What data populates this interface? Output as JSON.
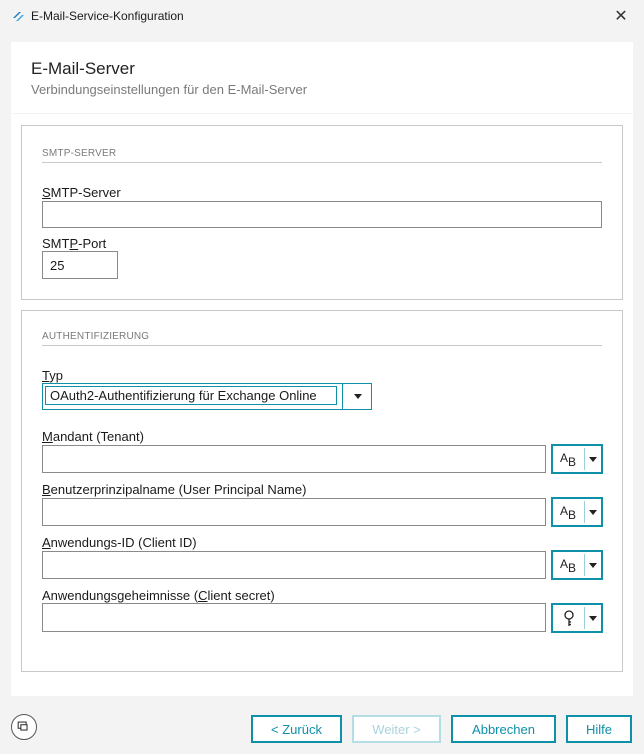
{
  "window": {
    "title": "E-Mail-Service-Konfiguration",
    "close_label": "✕"
  },
  "header": {
    "title": "E-Mail-Server",
    "subtitle": "Verbindungseinstellungen für den E-Mail-Server"
  },
  "smtp": {
    "group_title": "SMTP-SERVER",
    "server_label_u": "S",
    "server_label_rest": "MTP-Server",
    "server_value": "",
    "port_label_a": "SMT",
    "port_label_u": "P",
    "port_label_b": "-Port",
    "port_value": "25"
  },
  "auth": {
    "group_title": "AUTHENTIFIZIERUNG",
    "type_label_u": "T",
    "type_label_rest": "yp",
    "type_value": "OAuth2-Authentifizierung für Exchange Online",
    "tenant_label_u": "M",
    "tenant_label_rest": "andant (Tenant)",
    "tenant_value": "",
    "upn_label_u": "B",
    "upn_label_rest": "enutzerprinzipalname (User Principal Name)",
    "upn_value": "",
    "clientid_label_u": "A",
    "clientid_label_rest": "nwendungs-ID (Client ID)",
    "clientid_value": "",
    "secret_label_a": "Anwendungsgeheimnisse (",
    "secret_label_u": "C",
    "secret_label_b": "lient secret)",
    "secret_value": ""
  },
  "icons": {
    "text_mode": "A_B",
    "secret_mode": "key-icon",
    "help": "help-icon"
  },
  "buttons": {
    "back": "< Zurück",
    "next": "Weiter >",
    "cancel": "Abbrechen",
    "help": "Hilfe"
  },
  "colors": {
    "accent": "#0e90a8",
    "disabled": "#a9d3dc",
    "border": "#c9c9c9"
  }
}
